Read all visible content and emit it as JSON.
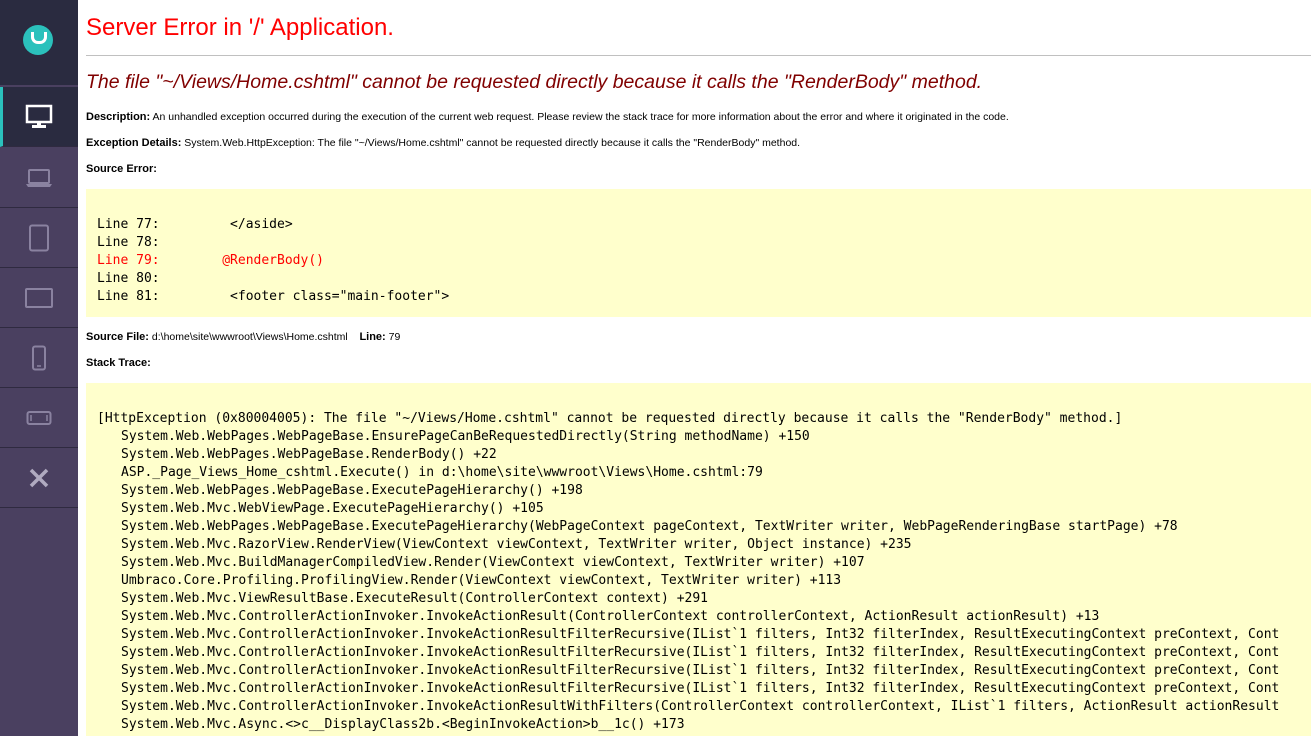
{
  "sidebar": {
    "logo_icon": "umbraco-logo-icon",
    "accent_color": "#2bc1bc",
    "items": [
      {
        "name": "desktop",
        "icon": "desktop-monitor-icon",
        "active": true
      },
      {
        "name": "laptop",
        "icon": "laptop-icon",
        "active": false
      },
      {
        "name": "tablet-portrait",
        "icon": "tablet-portrait-icon",
        "active": false
      },
      {
        "name": "tablet-landscape",
        "icon": "tablet-landscape-icon",
        "active": false
      },
      {
        "name": "phone-portrait",
        "icon": "phone-portrait-icon",
        "active": false
      },
      {
        "name": "phone-landscape",
        "icon": "phone-landscape-icon",
        "active": false
      },
      {
        "name": "close",
        "icon": "close-icon",
        "active": false
      }
    ]
  },
  "error": {
    "title": "Server Error in '/' Application.",
    "title_color": "#ff0000",
    "subtitle": "The file \"~/Views/Home.cshtml\" cannot be requested directly because it calls the \"RenderBody\" method.",
    "subtitle_color": "#800000",
    "description_label": "Description:",
    "description_text": "An unhandled exception occurred during the execution of the current web request. Please review the stack trace for more information about the error and where it originated in the code.",
    "exception_label": "Exception Details:",
    "exception_text": "System.Web.HttpException: The file \"~/Views/Home.cshtml\" cannot be requested directly because it calls the \"RenderBody\" method.",
    "source_error_label": "Source Error:",
    "source_lines": [
      {
        "text": "Line 77:         </aside>",
        "highlight": false
      },
      {
        "text": "Line 78:",
        "highlight": false
      },
      {
        "text": "Line 79:        @RenderBody()",
        "highlight": true
      },
      {
        "text": "Line 80:",
        "highlight": false
      },
      {
        "text": "Line 81:         <footer class=\"main-footer\">",
        "highlight": false
      }
    ],
    "source_file_label": "Source File:",
    "source_file_value": "d:\\home\\site\\wwwroot\\Views\\Home.cshtml",
    "line_label": "Line:",
    "line_value": "79",
    "stack_trace_label": "Stack Trace:",
    "stack_header": "[HttpException (0x80004005): The file \"~/Views/Home.cshtml\" cannot be requested directly because it calls the \"RenderBody\" method.]",
    "stack_frames": [
      "System.Web.WebPages.WebPageBase.EnsurePageCanBeRequestedDirectly(String methodName) +150",
      "System.Web.WebPages.WebPageBase.RenderBody() +22",
      "ASP._Page_Views_Home_cshtml.Execute() in d:\\home\\site\\wwwroot\\Views\\Home.cshtml:79",
      "System.Web.WebPages.WebPageBase.ExecutePageHierarchy() +198",
      "System.Web.Mvc.WebViewPage.ExecutePageHierarchy() +105",
      "System.Web.WebPages.WebPageBase.ExecutePageHierarchy(WebPageContext pageContext, TextWriter writer, WebPageRenderingBase startPage) +78",
      "System.Web.Mvc.RazorView.RenderView(ViewContext viewContext, TextWriter writer, Object instance) +235",
      "System.Web.Mvc.BuildManagerCompiledView.Render(ViewContext viewContext, TextWriter writer) +107",
      "Umbraco.Core.Profiling.ProfilingView.Render(ViewContext viewContext, TextWriter writer) +113",
      "System.Web.Mvc.ViewResultBase.ExecuteResult(ControllerContext context) +291",
      "System.Web.Mvc.ControllerActionInvoker.InvokeActionResult(ControllerContext controllerContext, ActionResult actionResult) +13",
      "System.Web.Mvc.ControllerActionInvoker.InvokeActionResultFilterRecursive(IList`1 filters, Int32 filterIndex, ResultExecutingContext preContext, Cont",
      "System.Web.Mvc.ControllerActionInvoker.InvokeActionResultFilterRecursive(IList`1 filters, Int32 filterIndex, ResultExecutingContext preContext, Cont",
      "System.Web.Mvc.ControllerActionInvoker.InvokeActionResultFilterRecursive(IList`1 filters, Int32 filterIndex, ResultExecutingContext preContext, Cont",
      "System.Web.Mvc.ControllerActionInvoker.InvokeActionResultFilterRecursive(IList`1 filters, Int32 filterIndex, ResultExecutingContext preContext, Cont",
      "System.Web.Mvc.ControllerActionInvoker.InvokeActionResultWithFilters(ControllerContext controllerContext, IList`1 filters, ActionResult actionResult",
      "System.Web.Mvc.Async.<>c__DisplayClass2b.<BeginInvokeAction>b__1c() +173"
    ]
  }
}
